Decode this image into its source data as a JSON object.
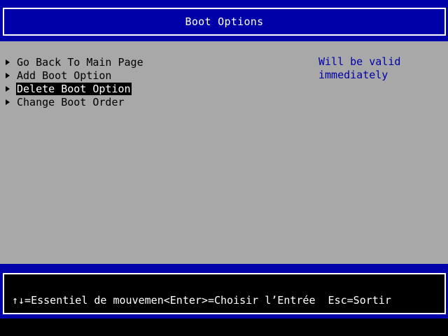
{
  "header": {
    "title": "Boot Options"
  },
  "menu": {
    "items": [
      {
        "label": "Go Back To Main Page",
        "selected": false
      },
      {
        "label": "Add Boot Option",
        "selected": false
      },
      {
        "label": "Delete Boot Option",
        "selected": true
      },
      {
        "label": "Change Boot Order",
        "selected": false
      }
    ],
    "arrow_icon": "triangle-right-icon"
  },
  "help": {
    "line1": "Will be valid",
    "line2": "immediately"
  },
  "footer": {
    "hint": "↑↓=Essentiel de mouvemen<Enter>=Choisir l’Entrée  Esc=Sortir"
  },
  "colors": {
    "bios_blue": "#0000a8",
    "panel_gray": "#a8a8a8",
    "selection_bg": "#000000",
    "selection_fg": "#ffffff",
    "help_text": "#0000a8"
  }
}
